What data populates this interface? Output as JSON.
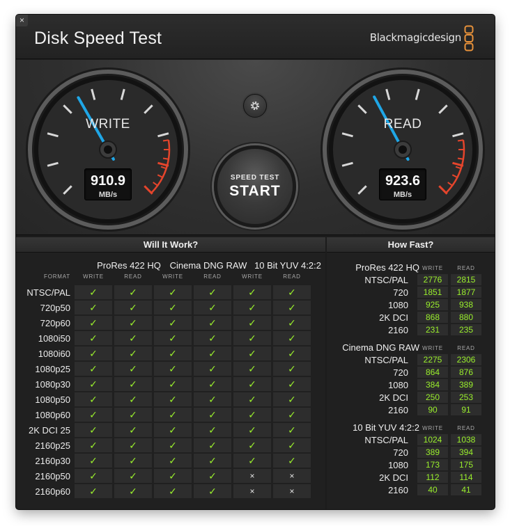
{
  "window": {
    "title": "Disk Speed Test",
    "brand": "Blackmagicdesign",
    "close_glyph": "×",
    "accent_color": "#1fa6e6",
    "ok_color": "#9aef2c",
    "redline_color": "#e5452c"
  },
  "gauges": {
    "write": {
      "label": "WRITE",
      "value": "910.9",
      "unit": "MB/s",
      "needle_fraction": 0.39
    },
    "read": {
      "label": "READ",
      "value": "923.6",
      "unit": "MB/s",
      "needle_fraction": 0.395
    }
  },
  "controls": {
    "settings_icon": "gear-icon",
    "start_top": "SPEED TEST",
    "start_main": "START"
  },
  "will_it_work": {
    "title": "Will It Work?",
    "format_label": "FORMAT",
    "write_label": "WRITE",
    "read_label": "READ",
    "groups": [
      "ProRes 422 HQ",
      "Cinema DNG RAW",
      "10 Bit YUV 4:2:2"
    ],
    "rows": [
      {
        "format": "NTSC/PAL",
        "cells": [
          "✓",
          "✓",
          "✓",
          "✓",
          "✓",
          "✓"
        ]
      },
      {
        "format": "720p50",
        "cells": [
          "✓",
          "✓",
          "✓",
          "✓",
          "✓",
          "✓"
        ]
      },
      {
        "format": "720p60",
        "cells": [
          "✓",
          "✓",
          "✓",
          "✓",
          "✓",
          "✓"
        ]
      },
      {
        "format": "1080i50",
        "cells": [
          "✓",
          "✓",
          "✓",
          "✓",
          "✓",
          "✓"
        ]
      },
      {
        "format": "1080i60",
        "cells": [
          "✓",
          "✓",
          "✓",
          "✓",
          "✓",
          "✓"
        ]
      },
      {
        "format": "1080p25",
        "cells": [
          "✓",
          "✓",
          "✓",
          "✓",
          "✓",
          "✓"
        ]
      },
      {
        "format": "1080p30",
        "cells": [
          "✓",
          "✓",
          "✓",
          "✓",
          "✓",
          "✓"
        ]
      },
      {
        "format": "1080p50",
        "cells": [
          "✓",
          "✓",
          "✓",
          "✓",
          "✓",
          "✓"
        ]
      },
      {
        "format": "1080p60",
        "cells": [
          "✓",
          "✓",
          "✓",
          "✓",
          "✓",
          "✓"
        ]
      },
      {
        "format": "2K DCI 25",
        "cells": [
          "✓",
          "✓",
          "✓",
          "✓",
          "✓",
          "✓"
        ]
      },
      {
        "format": "2160p25",
        "cells": [
          "✓",
          "✓",
          "✓",
          "✓",
          "✓",
          "✓"
        ]
      },
      {
        "format": "2160p30",
        "cells": [
          "✓",
          "✓",
          "✓",
          "✓",
          "✓",
          "✓"
        ]
      },
      {
        "format": "2160p50",
        "cells": [
          "✓",
          "✓",
          "✓",
          "✓",
          "×",
          "×"
        ]
      },
      {
        "format": "2160p60",
        "cells": [
          "✓",
          "✓",
          "✓",
          "✓",
          "×",
          "×"
        ]
      }
    ]
  },
  "how_fast": {
    "title": "How Fast?",
    "write_label": "WRITE",
    "read_label": "READ",
    "sections": [
      {
        "name": "ProRes 422 HQ",
        "rows": [
          {
            "format": "NTSC/PAL",
            "write": "2776",
            "read": "2815"
          },
          {
            "format": "720",
            "write": "1851",
            "read": "1877"
          },
          {
            "format": "1080",
            "write": "925",
            "read": "938"
          },
          {
            "format": "2K DCI",
            "write": "868",
            "read": "880"
          },
          {
            "format": "2160",
            "write": "231",
            "read": "235"
          }
        ]
      },
      {
        "name": "Cinema DNG RAW",
        "rows": [
          {
            "format": "NTSC/PAL",
            "write": "2275",
            "read": "2306"
          },
          {
            "format": "720",
            "write": "864",
            "read": "876"
          },
          {
            "format": "1080",
            "write": "384",
            "read": "389"
          },
          {
            "format": "2K DCI",
            "write": "250",
            "read": "253"
          },
          {
            "format": "2160",
            "write": "90",
            "read": "91"
          }
        ]
      },
      {
        "name": "10 Bit YUV 4:2:2",
        "rows": [
          {
            "format": "NTSC/PAL",
            "write": "1024",
            "read": "1038"
          },
          {
            "format": "720",
            "write": "389",
            "read": "394"
          },
          {
            "format": "1080",
            "write": "173",
            "read": "175"
          },
          {
            "format": "2K DCI",
            "write": "112",
            "read": "114"
          },
          {
            "format": "2160",
            "write": "40",
            "read": "41"
          }
        ]
      }
    ]
  }
}
